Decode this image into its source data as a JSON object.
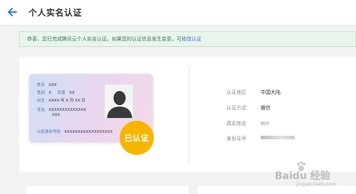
{
  "header": {
    "title": "个人实名认证"
  },
  "notice": {
    "text": "恭喜，您已完成腾讯云个人实名认证。如果您的认证信息发生变更，可",
    "link_label": "修改认证"
  },
  "id_card": {
    "name_label": "姓名",
    "name_value": "XXX",
    "gender_label": "性别",
    "gender_value": "X",
    "ethnicity_label": "民族",
    "ethnicity_value": "XX",
    "birth_label": "出生",
    "birth_value": "XXXX 年 X 月 XX 日",
    "address_label": "住址",
    "address_line1": "XXXXXXXXXXXXXX",
    "address_line2": "XXX",
    "id_number_label": "公民身份号码",
    "id_number_value": "XXXXXXXXXXXXXXXXXX"
  },
  "badge": {
    "label": "已认证"
  },
  "info": {
    "items": [
      {
        "label": "认证地区",
        "value": "中国大陆"
      },
      {
        "label": "认证方式",
        "value": "微信"
      },
      {
        "label": "真实姓名",
        "value": ""
      },
      {
        "label": "身份证号",
        "value": ""
      }
    ]
  },
  "watermark": {
    "text": "Baidu 经验",
    "url": "jingyan.baidu.com"
  },
  "colors": {
    "accent_blue": "#1a6fe8",
    "badge_yellow": "#f7b500",
    "notice_bg": "#e9f5ec",
    "link_blue": "#3b6dd9"
  },
  "icons": {
    "back": "arrow-left-icon",
    "portrait": "person-silhouette-icon",
    "watermark_logo": "paw-icon"
  }
}
